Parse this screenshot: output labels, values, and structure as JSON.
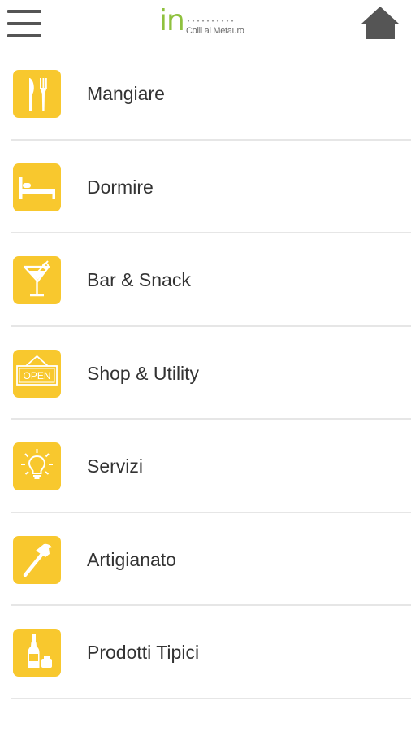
{
  "header": {
    "logo_main": "in",
    "logo_sub": "Colli al Metauro",
    "menu_icon": "hamburger-menu-icon",
    "home_icon": "home-icon"
  },
  "colors": {
    "accent": "#f8c82e",
    "logo_green": "#8fc13e",
    "text": "#333333",
    "divider": "#e6e6e6",
    "icon_gray": "#555555"
  },
  "menu": {
    "items": [
      {
        "label": "Mangiare",
        "icon": "fork-knife-icon"
      },
      {
        "label": "Dormire",
        "icon": "bed-icon"
      },
      {
        "label": "Bar & Snack",
        "icon": "cocktail-glass-icon"
      },
      {
        "label": "Shop & Utility",
        "icon": "open-sign-icon",
        "icon_text": "OPEN"
      },
      {
        "label": "Servizi",
        "icon": "lightbulb-icon"
      },
      {
        "label": "Artigianato",
        "icon": "hammer-icon"
      },
      {
        "label": "Prodotti Tipici",
        "icon": "wine-bottle-icon"
      }
    ]
  }
}
